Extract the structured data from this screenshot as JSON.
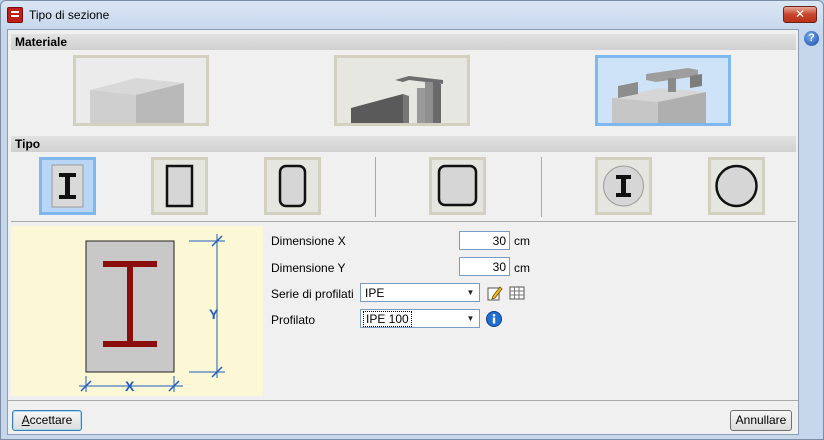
{
  "window": {
    "title": "Tipo di sezione",
    "close_glyph": "✕",
    "help_glyph": "?"
  },
  "sections": {
    "materiale": "Materiale",
    "tipo": "Tipo"
  },
  "materials": [
    {
      "id": "concrete",
      "icon": "concrete-block-icon",
      "selected": false
    },
    {
      "id": "steel",
      "icon": "steel-profile-icon",
      "selected": false
    },
    {
      "id": "composite",
      "icon": "composite-section-icon",
      "selected": true
    }
  ],
  "types": [
    {
      "id": "i-encased",
      "icon": "i-section-icon",
      "selected": true
    },
    {
      "id": "rect-thin",
      "icon": "rectangular-section-icon",
      "selected": false
    },
    {
      "id": "rect-rounded",
      "icon": "rounded-rectangle-section-icon",
      "selected": false
    },
    {
      "id": "square-rounded",
      "icon": "square-tube-section-icon",
      "selected": false
    },
    {
      "id": "circle-i",
      "icon": "circular-i-section-icon",
      "selected": false
    },
    {
      "id": "circle",
      "icon": "circular-section-icon",
      "selected": false
    }
  ],
  "preview": {
    "label_x": "X",
    "label_y": "Y"
  },
  "form": {
    "dim_x_label": "Dimensione X",
    "dim_x_value": "30",
    "dim_x_unit": "cm",
    "dim_y_label": "Dimensione Y",
    "dim_y_value": "30",
    "dim_y_unit": "cm",
    "serie_label": "Serie di profilati",
    "serie_value": "IPE",
    "profilato_label": "Profilato",
    "profilato_value": "IPE 100"
  },
  "buttons": {
    "accept_first": "A",
    "accept_rest": "ccettare",
    "cancel": "Annullare"
  },
  "colors": {
    "selected_border": "#7fb8ef",
    "steel_profile": "#8b0e0e",
    "accent_blue": "#1a4fa8"
  }
}
